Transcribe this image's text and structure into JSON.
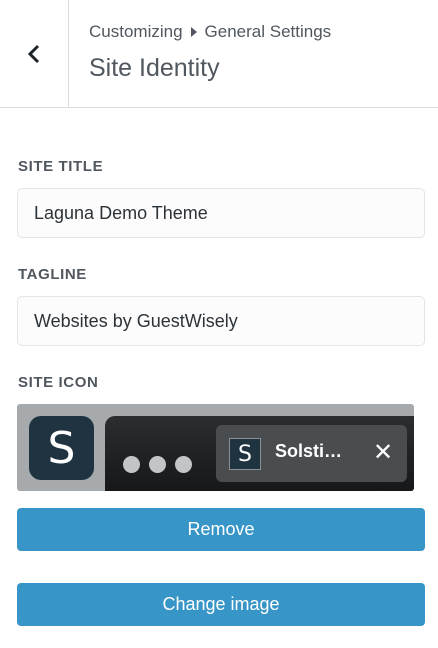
{
  "header": {
    "back_icon": "chevron-left-icon",
    "breadcrumb_root": "Customizing",
    "breadcrumb_current": "General Settings",
    "title": "Site Identity"
  },
  "site_title": {
    "label": "SITE TITLE",
    "value": "Laguna Demo Theme"
  },
  "tagline": {
    "label": "TAGLINE",
    "value": "Websites by GuestWisely"
  },
  "site_icon": {
    "label": "SITE ICON",
    "app_icon_letter": "S",
    "tab_favicon_letter": "S",
    "tab_title": "Solsti…",
    "close_glyph": "✕"
  },
  "buttons": {
    "remove": "Remove",
    "change_image": "Change image"
  },
  "colors": {
    "accent": "#3895c7",
    "icon_bg": "#1f3440"
  }
}
